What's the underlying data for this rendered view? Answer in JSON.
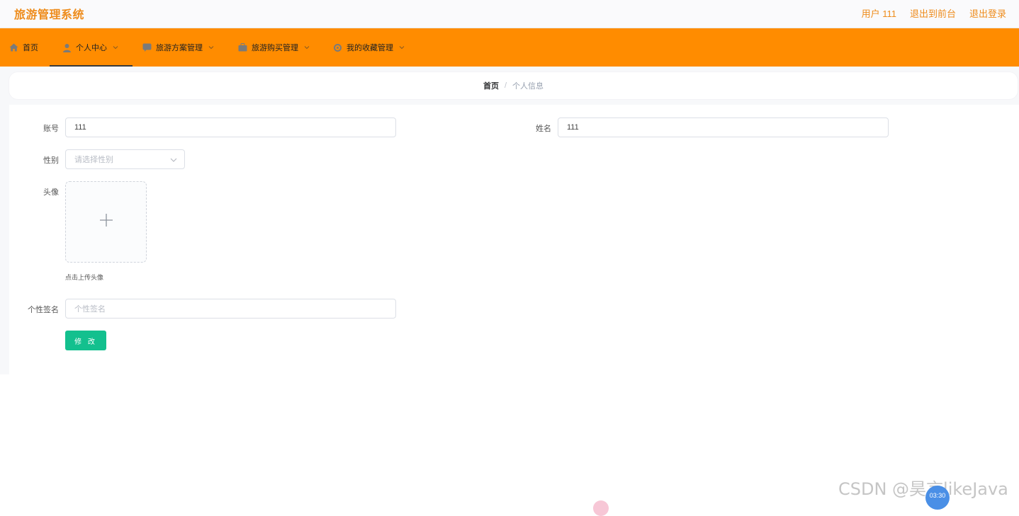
{
  "header": {
    "brand": "旅游管理系统",
    "links": [
      "用户 111",
      "退出到前台",
      "退出登录"
    ]
  },
  "nav": {
    "items": [
      {
        "label": "首页",
        "icon": "home-icon"
      },
      {
        "label": "个人中心",
        "icon": "user-icon"
      },
      {
        "label": "旅游方案管理",
        "icon": "chat-icon"
      },
      {
        "label": "旅游购买管理",
        "icon": "briefcase-icon"
      },
      {
        "label": "我的收藏管理",
        "icon": "gear-icon"
      }
    ],
    "active_index": 1
  },
  "breadcrumb": {
    "home": "首页",
    "separator": "/",
    "current": "个人信息"
  },
  "form": {
    "account": {
      "label": "账号",
      "value": "111"
    },
    "name": {
      "label": "姓名",
      "value": "111"
    },
    "gender": {
      "label": "性别",
      "placeholder": "请选择性别"
    },
    "avatar": {
      "label": "头像",
      "hint": "点击上传头像"
    },
    "signature": {
      "label": "个性签名",
      "placeholder": "个性签名"
    },
    "submit_label": "修 改"
  },
  "overlay": {
    "watermark": "CSDN @昊言likeJava",
    "timer": "03:30"
  },
  "colors": {
    "brand": "#ee8c1c",
    "nav_bg": "#ff8c00",
    "button": "#13c08e"
  }
}
